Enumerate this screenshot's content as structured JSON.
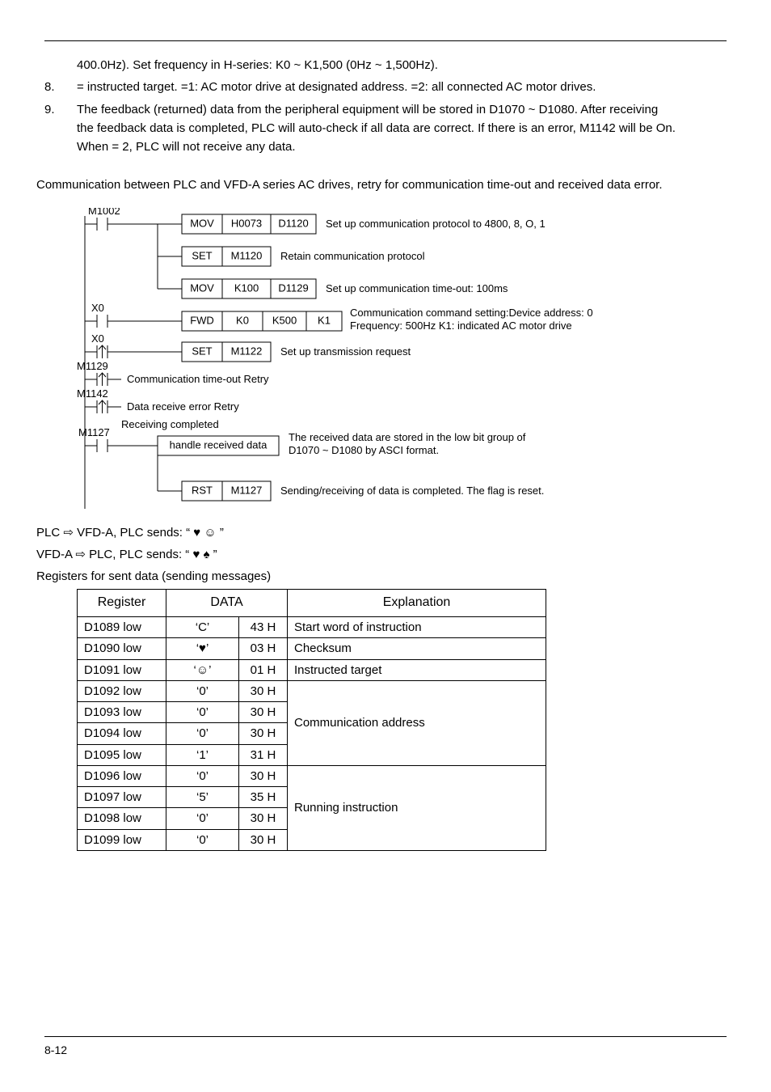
{
  "para_cont": "400.0Hz). Set frequency in H-series: K0 ~ K1,500 (0Hz ~ 1,500Hz).",
  "item8": {
    "num": "8.",
    "text": "   = instructed target.   =1: AC motor drive at designated address.   =2: all connected AC motor drives."
  },
  "item9": {
    "num": "9.",
    "l1": "The feedback (returned) data from the peripheral equipment will be stored in D1070 ~ D1080. After receiving",
    "l2": "the feedback data is completed, PLC will auto-check if all data are correct. If there is an error, M1142 will be On.",
    "l3": "When    = 2, PLC will not receive any data."
  },
  "lead": "Communication between PLC and VFD-A series AC drives, retry for communication time-out and received data error.",
  "ladder": {
    "m1002": "M1002",
    "x0": "X0",
    "m1129": "M1129",
    "m1142": "M1142",
    "m1127": "M1127",
    "row1": {
      "op": "MOV",
      "a": "H0073",
      "b": "D1120",
      "desc": "Set up communication protocol to 4800, 8, O, 1"
    },
    "row2": {
      "op": "SET",
      "a": "M1120",
      "desc": "Retain communication protocol"
    },
    "row3": {
      "op": "MOV",
      "a": "K100",
      "b": "D1129",
      "desc": "Set up communication time-out: 100ms"
    },
    "row4": {
      "op": "FWD",
      "a": "K0",
      "b": "K500",
      "c": "K1",
      "d1": "Communication command setting:Device address: 0",
      "d2": "Frequency: 500Hz K1: indicated AC motor drive"
    },
    "row5": {
      "op": "SET",
      "a": "M1122",
      "desc": "Set up transmission request"
    },
    "row6": {
      "desc": "Communication time-out Retry"
    },
    "row7": {
      "desc": "Data receive error Retry"
    },
    "row8pre": "Receiving completed",
    "row8": {
      "box": "handle received data",
      "d1": "The received data are stored in the low bit group of",
      "d2": "D1070 ~ D1080 by ASCI format."
    },
    "row9": {
      "op": "RST",
      "a": "M1127",
      "desc": "Sending/receiving of data is completed. The flag is reset."
    }
  },
  "plc_sends": "PLC ⇨ VFD-A, PLC sends: “   ♥ ☺                  ”",
  "vfd_sends": "VFD-A ⇨ PLC, PLC sends: “   ♥ ♠                  ”",
  "reg_caption": "Registers for sent data (sending messages)",
  "thead": {
    "reg": "Register",
    "data": "DATA",
    "exp": "Explanation"
  },
  "rows": [
    {
      "reg": "D1089 low",
      "ch": "‘C’",
      "hex": "43 H"
    },
    {
      "reg": "D1090 low",
      "ch": "‘♥’",
      "hex": "03 H"
    },
    {
      "reg": "D1091 low",
      "ch": "‘☺’",
      "hex": "01 H"
    },
    {
      "reg": "D1092 low",
      "ch": "‘0’",
      "hex": "30 H"
    },
    {
      "reg": "D1093 low",
      "ch": "‘0’",
      "hex": "30 H"
    },
    {
      "reg": "D1094 low",
      "ch": "‘0’",
      "hex": "30 H"
    },
    {
      "reg": "D1095 low",
      "ch": "‘1’",
      "hex": "31 H"
    },
    {
      "reg": "D1096 low",
      "ch": "‘0’",
      "hex": "30 H"
    },
    {
      "reg": "D1097 low",
      "ch": "‘5’",
      "hex": "35 H"
    },
    {
      "reg": "D1098 low",
      "ch": "‘0’",
      "hex": "30 H"
    },
    {
      "reg": "D1099 low",
      "ch": "‘0’",
      "hex": "30 H"
    }
  ],
  "exp": {
    "r0": "Start word of instruction",
    "r1": "Checksum",
    "r2": "Instructed target",
    "g1": "Communication address",
    "g2": "Running instruction"
  },
  "page_num": "8-12"
}
